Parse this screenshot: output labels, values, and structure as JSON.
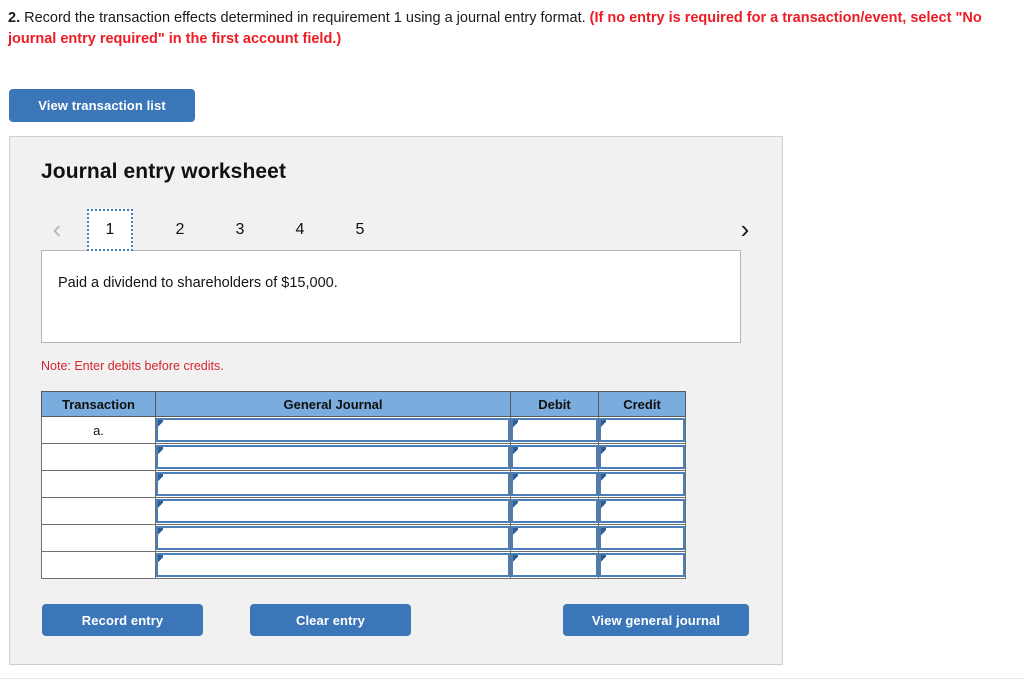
{
  "question": {
    "number": "2.",
    "text": " Record the transaction effects determined in requirement 1 using a journal entry format. ",
    "emphasis": "(If no entry is required for a transaction/event, select \"No journal entry required\" in the first account field.)"
  },
  "toolbar": {
    "view_transaction_list_label": "View transaction list"
  },
  "worksheet": {
    "title": "Journal entry worksheet",
    "pager": {
      "prev_icon": "chevron-left-icon",
      "next_icon": "chevron-right-icon",
      "prev_glyph": "‹",
      "next_glyph": "›",
      "tabs": [
        "1",
        "2",
        "3",
        "4",
        "5"
      ],
      "active_tab": "1"
    },
    "transaction_description": "Paid a dividend to shareholders of $15,000.",
    "note": "Note: Enter debits before credits.",
    "table": {
      "headers": [
        "Transaction",
        "General Journal",
        "Debit",
        "Credit"
      ],
      "rows": [
        {
          "transaction": "a.",
          "general_journal": "",
          "debit": "",
          "credit": ""
        },
        {
          "transaction": "",
          "general_journal": "",
          "debit": "",
          "credit": ""
        },
        {
          "transaction": "",
          "general_journal": "",
          "debit": "",
          "credit": ""
        },
        {
          "transaction": "",
          "general_journal": "",
          "debit": "",
          "credit": ""
        },
        {
          "transaction": "",
          "general_journal": "",
          "debit": "",
          "credit": ""
        },
        {
          "transaction": "",
          "general_journal": "",
          "debit": "",
          "credit": ""
        }
      ]
    },
    "actions": {
      "record_entry_label": "Record entry",
      "clear_entry_label": "Clear entry",
      "view_general_journal_label": "View general journal"
    }
  },
  "colors": {
    "button_blue": "#3b76b8",
    "table_header_blue": "#7aadde",
    "input_border_blue": "#4a7fba",
    "marker_blue": "#2f5e96",
    "alert_red": "#ed1c24",
    "note_red": "#d4262c",
    "panel_gray": "#f1f1f1"
  }
}
